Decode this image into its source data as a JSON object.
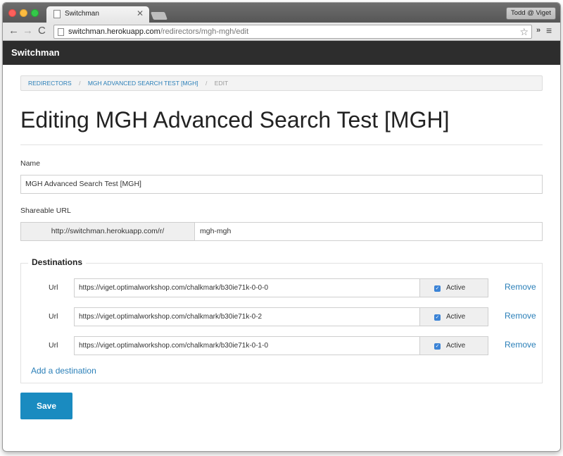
{
  "browser": {
    "tab_title": "Switchman",
    "tab_close": "✕",
    "profile_label": "Todd @ Viget",
    "url_host": "switchman.herokuapp.com",
    "url_path": "/redirectors/mgh-mgh/edit",
    "back_glyph": "←",
    "forward_glyph": "→",
    "reload_glyph": "C",
    "star_glyph": "☆",
    "extensions_glyph": "»",
    "menu_glyph": "≡"
  },
  "navbar": {
    "brand": "Switchman"
  },
  "breadcrumb": {
    "items": [
      "REDIRECTORS",
      "MGH ADVANCED SEARCH TEST [MGH]",
      "EDIT"
    ],
    "separator": "/"
  },
  "page": {
    "title": "Editing MGH Advanced Search Test [MGH]"
  },
  "form": {
    "name_label": "Name",
    "name_value": "MGH Advanced Search Test [MGH]",
    "shareable_label": "Shareable URL",
    "shareable_prefix": "http://switchman.herokuapp.com/r/",
    "shareable_value": "mgh-mgh",
    "destinations_legend": "Destinations",
    "destinations": [
      {
        "label": "Url",
        "url": "https://viget.optimalworkshop.com/chalkmark/b30ie71k-0-0-0",
        "active_label": "Active",
        "active": true,
        "remove_label": "Remove"
      },
      {
        "label": "Url",
        "url": "https://viget.optimalworkshop.com/chalkmark/b30ie71k-0-2",
        "active_label": "Active",
        "active": true,
        "remove_label": "Remove"
      },
      {
        "label": "Url",
        "url": "https://viget.optimalworkshop.com/chalkmark/b30ie71k-0-1-0",
        "active_label": "Active",
        "active": true,
        "remove_label": "Remove"
      }
    ],
    "add_destination_label": "Add a destination",
    "save_label": "Save"
  },
  "colors": {
    "link": "#2a7fb8",
    "primary_button": "#1a8bc0",
    "navbar": "#2d2d2d"
  }
}
